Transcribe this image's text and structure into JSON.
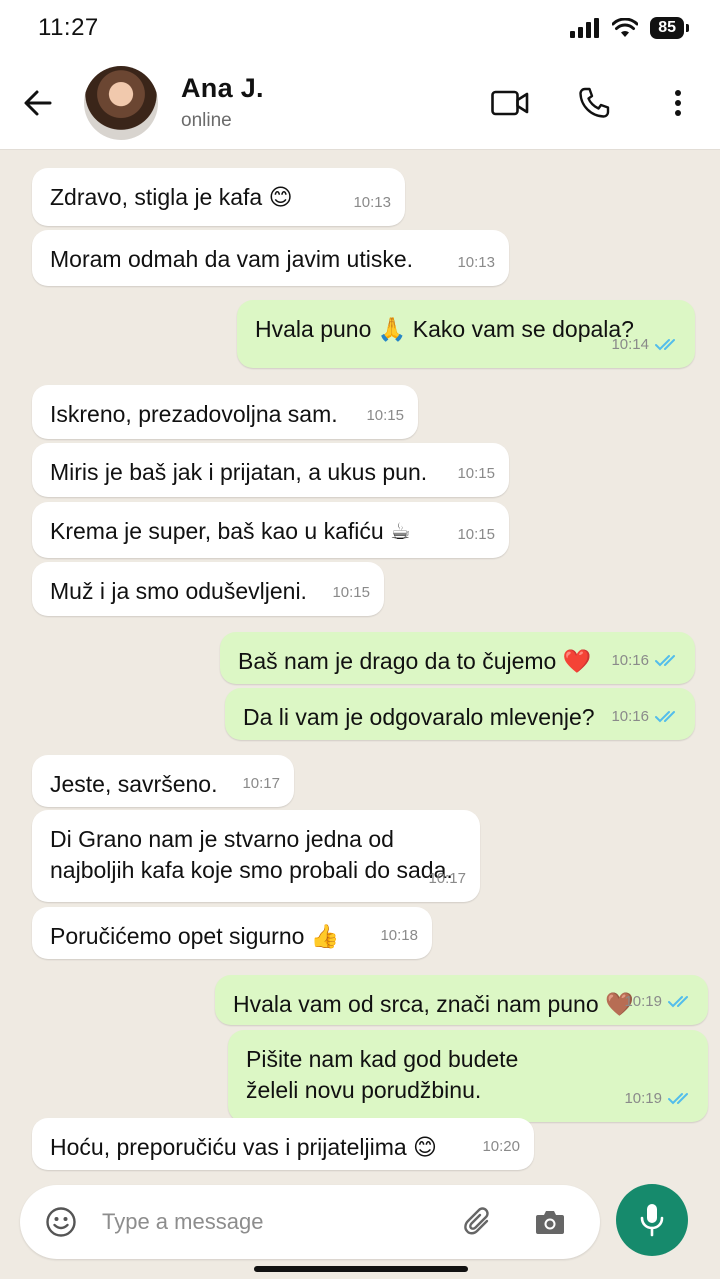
{
  "status_bar": {
    "time": "11:27",
    "battery": "85"
  },
  "header": {
    "contact_name": "Ana J.",
    "contact_status": "online"
  },
  "messages": [
    {
      "dir": "in",
      "text": "Zdravo, stigla je kafa 😊",
      "time": "10:13"
    },
    {
      "dir": "in",
      "text": "Moram odmah da vam javim utiske.",
      "time": "10:13"
    },
    {
      "dir": "out",
      "text": "Hvala puno 🙏 Kako vam se dopala?",
      "time": "10:14"
    },
    {
      "dir": "in",
      "text": "Iskreno, prezadovoljna sam.",
      "time": "10:15"
    },
    {
      "dir": "in",
      "text": "Miris je baš jak i prijatan, a ukus pun.",
      "time": "10:15"
    },
    {
      "dir": "in",
      "text": "Krema je super, baš kao u kafiću ☕",
      "time": "10:15"
    },
    {
      "dir": "in",
      "text": "Muž i ja smo oduševljeni.",
      "time": "10:15"
    },
    {
      "dir": "out",
      "text": "Baš nam je drago da to čujemo ❤️",
      "time": "10:16"
    },
    {
      "dir": "out",
      "text": "Da li vam je odgovaralo mlevenje?",
      "time": "10:16"
    },
    {
      "dir": "in",
      "text": "Jeste, savršeno.",
      "time": "10:17"
    },
    {
      "dir": "in",
      "text": "Di Grano nam je stvarno jedna od najboljih kafa koje smo probali do sada.",
      "time": "10:17"
    },
    {
      "dir": "in",
      "text": "Poručićemo opet sigurno 👍",
      "time": "10:18"
    },
    {
      "dir": "out",
      "text": "Hvala vam od srca, znači nam puno 🤎",
      "time": "10:19"
    },
    {
      "dir": "out",
      "text": "Pišite nam kad god budete želeli novu porudžbinu.",
      "time": "10:19"
    },
    {
      "dir": "in",
      "text": "Hoću, preporučiću vas i prijateljima 😊",
      "time": "10:20"
    }
  ],
  "composer": {
    "placeholder": "Type a message"
  },
  "icons": {
    "back": "arrow-left-icon",
    "video": "video-camera-icon",
    "call": "phone-icon",
    "menu": "more-vertical-icon",
    "emoji": "emoji-icon",
    "attach": "paperclip-icon",
    "camera": "camera-icon",
    "mic": "microphone-icon",
    "read_receipt": "double-check-icon"
  },
  "colors": {
    "chat_background": "#efeae2",
    "incoming_bubble": "#ffffff",
    "outgoing_bubble": "#dcf7c5",
    "read_check": "#53bdeb",
    "mic_button": "#168a6c"
  }
}
